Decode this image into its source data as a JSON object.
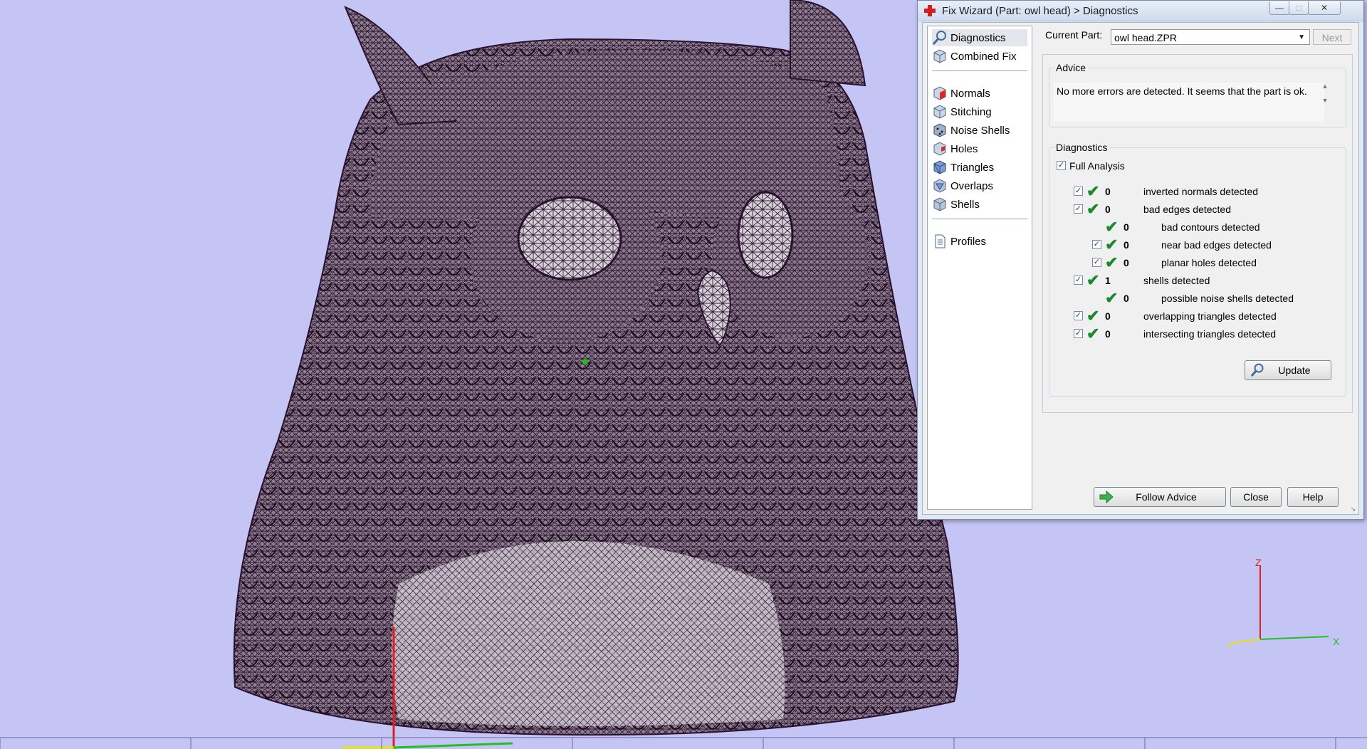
{
  "window": {
    "title": "Fix Wizard (Part: owl head) > Diagnostics",
    "controls": {
      "minimize": "—",
      "maximize": "□",
      "close": "✕"
    }
  },
  "nav": {
    "items": [
      {
        "label": "Diagnostics",
        "icon": "magnifier-icon"
      },
      {
        "label": "Combined Fix",
        "icon": "cube-icon"
      },
      {
        "label": "Normals",
        "icon": "cube-red-face-icon"
      },
      {
        "label": "Stitching",
        "icon": "cube-icon"
      },
      {
        "label": "Noise Shells",
        "icon": "dotted-cube-icon"
      },
      {
        "label": "Holes",
        "icon": "cube-red-hole-icon"
      },
      {
        "label": "Triangles",
        "icon": "cube-blue-icon"
      },
      {
        "label": "Overlaps",
        "icon": "cube-overlap-icon"
      },
      {
        "label": "Shells",
        "icon": "cube-icon"
      },
      {
        "label": "Profiles",
        "icon": "document-icon"
      }
    ]
  },
  "current_part": {
    "label": "Current Part:",
    "value": "owl head.ZPR"
  },
  "next_button": "Next",
  "advice": {
    "title": "Advice",
    "text": "No more errors are detected. It seems that the part is ok."
  },
  "diagnostics": {
    "title": "Diagnostics",
    "full_analysis": "Full Analysis",
    "rows": [
      {
        "count": "0",
        "label": "inverted normals detected"
      },
      {
        "count": "0",
        "label": "bad edges detected"
      },
      {
        "count": "0",
        "label": "bad contours detected"
      },
      {
        "count": "0",
        "label": "near bad edges detected"
      },
      {
        "count": "0",
        "label": "planar holes detected"
      },
      {
        "count": "1",
        "label": "shells detected"
      },
      {
        "count": "0",
        "label": "possible noise shells detected"
      },
      {
        "count": "0",
        "label": "overlapping triangles detected"
      },
      {
        "count": "0",
        "label": "intersecting triangles detected"
      }
    ],
    "update_button": "Update"
  },
  "footer": {
    "follow_advice": "Follow Advice",
    "close": "Close",
    "help": "Help"
  },
  "axes": {
    "x": "X",
    "y": "Y",
    "z": "Z"
  },
  "colors": {
    "viewport_bg": "#c5c5f5",
    "mesh_fill": "#c9c5cc",
    "mesh_lines": "#3a1d3a",
    "check_green": "#1b8a2a",
    "axis_red": "#e02020",
    "axis_green": "#20c020"
  }
}
